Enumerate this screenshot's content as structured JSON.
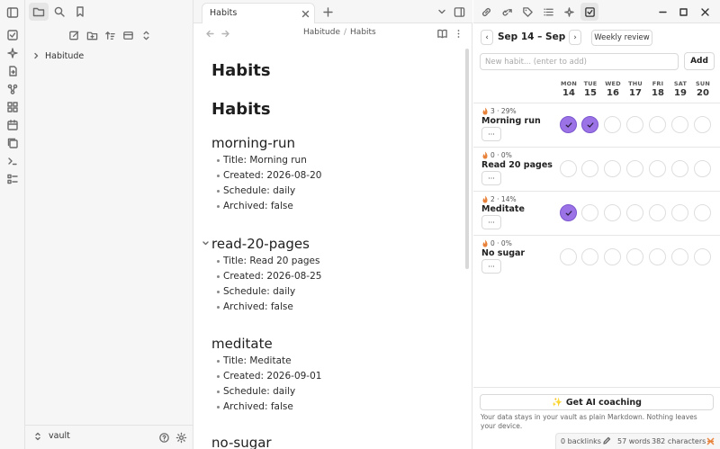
{
  "ribbon": {
    "icons": [
      "sidebar-toggle-icon",
      "daily-note-icon",
      "sparkle-icon",
      "file-import-icon",
      "graph-icon",
      "blocks-icon",
      "calendar-icon",
      "copy-icon",
      "terminal-icon",
      "list-icon"
    ]
  },
  "sidebar": {
    "tabs": [
      "files-icon",
      "search-icon",
      "bookmark-icon"
    ],
    "tools": [
      "new-note-icon",
      "new-folder-icon",
      "sort-icon",
      "collapse-icon",
      "expand-icon"
    ],
    "tree": [
      {
        "label": "Habitude"
      }
    ],
    "vault_name": "vault"
  },
  "center": {
    "tab_title": "Habits",
    "breadcrumb": {
      "folder": "Habitude",
      "separator": "/",
      "file": "Habits"
    },
    "doc": {
      "title": "Habits",
      "heading": "Habits",
      "sections": [
        {
          "id": "morning-run",
          "items": [
            "Title: Morning run",
            "Created: 2026-08-20",
            "Schedule: daily",
            "Archived: false"
          ]
        },
        {
          "id": "read-20-pages",
          "items": [
            "Title: Read 20 pages",
            "Created: 2026-08-25",
            "Schedule: daily",
            "Archived: false"
          ]
        },
        {
          "id": "meditate",
          "items": [
            "Title: Meditate",
            "Created: 2026-09-01",
            "Schedule: daily",
            "Archived: false"
          ]
        },
        {
          "id": "no-sugar",
          "items": []
        }
      ]
    }
  },
  "habits_panel": {
    "range": "Sep 14 – Sep 20",
    "prev": "‹",
    "next": "›",
    "weekly_review": "Weekly review",
    "new_habit_placeholder": "New habit... (enter to add)",
    "new_habit_value": "",
    "add_label": "Add",
    "days": [
      {
        "name": "MON",
        "date": "14"
      },
      {
        "name": "TUE",
        "date": "15"
      },
      {
        "name": "WED",
        "date": "16"
      },
      {
        "name": "THU",
        "date": "17"
      },
      {
        "name": "FRI",
        "date": "18"
      },
      {
        "name": "SAT",
        "date": "19"
      },
      {
        "name": "SUN",
        "date": "20"
      }
    ],
    "habits": [
      {
        "streak": "3 · 29%",
        "name": "Morning run",
        "more": "···",
        "done": [
          true,
          true,
          false,
          false,
          false,
          false,
          false
        ]
      },
      {
        "streak": "0 · 0%",
        "name": "Read 20 pages",
        "more": "···",
        "done": [
          false,
          false,
          false,
          false,
          false,
          false,
          false
        ]
      },
      {
        "streak": "2 · 14%",
        "name": "Meditate",
        "more": "···",
        "done": [
          true,
          false,
          false,
          false,
          false,
          false,
          false
        ]
      },
      {
        "streak": "0 · 0%",
        "name": "No sugar",
        "more": "···",
        "done": [
          false,
          false,
          false,
          false,
          false,
          false,
          false
        ]
      }
    ],
    "ai_coaching": "Get AI coaching",
    "ai_icon": "✨",
    "privacy_note": "Your data stays in your vault as plain Markdown. Nothing leaves your device.",
    "accent_color": "#9b73e6",
    "flame_color": "#e8823a"
  },
  "status_bar": {
    "backlinks": "0 backlinks",
    "words": "57 words",
    "characters": "382 characters"
  }
}
